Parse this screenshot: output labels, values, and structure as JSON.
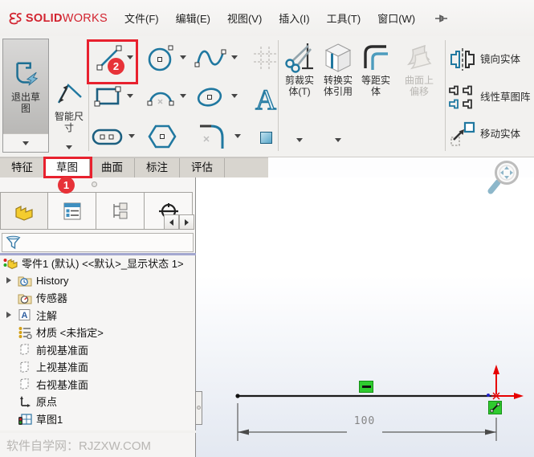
{
  "colors": {
    "logo_red": "#d2232f",
    "annotation_red": "#e8212e",
    "tool_blue": "#2078a0",
    "constraint_green": "#2fcb2f",
    "origin_red": "#e60000"
  },
  "menubar": {
    "logo_solid": "SOLID",
    "logo_works": "WORKS",
    "items": [
      "文件(F)",
      "编辑(E)",
      "视图(V)",
      "插入(I)",
      "工具(T)",
      "窗口(W)"
    ]
  },
  "ribbon": {
    "exit_sketch": "退出草图",
    "smart_dimension": "智能尺寸",
    "trim": "剪裁实体(T)",
    "convert": "转换实体引用",
    "offset": "等距实体",
    "surface_offset": "曲面上偏移",
    "mirror": "镜向实体",
    "linear_pattern": "线性草图阵",
    "move": "移动实体"
  },
  "annotations": {
    "badge_line_tool": "2",
    "badge_sketch_tab": "1"
  },
  "tabs": [
    "特征",
    "草图",
    "曲面",
    "标注",
    "评估"
  ],
  "feature_tree": {
    "root": "零件1 (默认) <<默认>_显示状态 1>",
    "items": [
      "History",
      "传感器",
      "注解",
      "材质 <未指定>",
      "前视基准面",
      "上视基准面",
      "右视基准面",
      "原点",
      "草图1"
    ]
  },
  "sketch": {
    "dimension_value": "100"
  },
  "statusbar": {
    "watermark": "软件自学网：RJZXW.COM"
  }
}
